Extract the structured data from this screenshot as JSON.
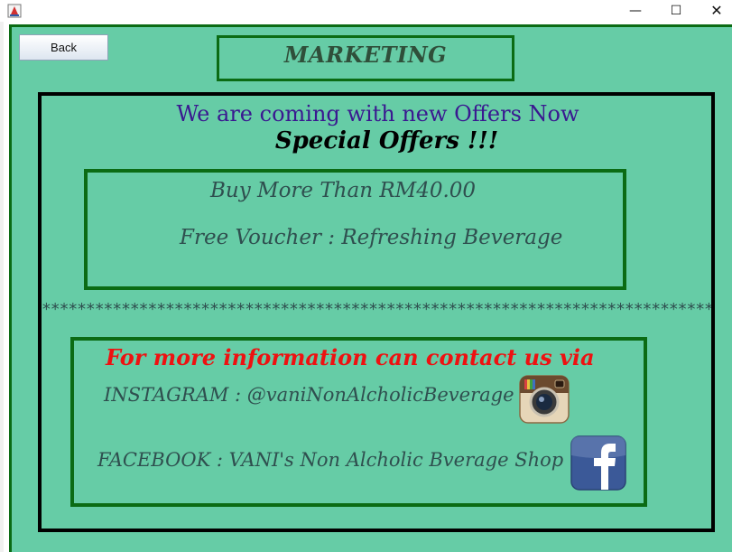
{
  "window": {
    "minimize": "—",
    "maximize": "☐",
    "close": "✕"
  },
  "toolbar": {
    "back_label": "Back"
  },
  "header": {
    "title": "MARKETING"
  },
  "promo": {
    "headline": "We are coming with new Offers Now",
    "special": "Special Offers !!!",
    "offer_line_1": "Buy More Than RM40.00",
    "offer_line_2": "Free Voucher : Refreshing Beverage"
  },
  "divider": "*****************************************************************************",
  "contact": {
    "title": "For more information can contact us via",
    "instagram": "INSTAGRAM : @vaniNonAlcholicBeverage",
    "facebook": "FACEBOOK  : VANI's Non Alcholic Bverage Shop"
  },
  "icons": {
    "app": "java-app-icon",
    "instagram": "instagram-icon",
    "facebook": "facebook-icon"
  },
  "colors": {
    "panel_background": "#66cca6",
    "frame_border": "#0b6b14",
    "headline": "#3a1890",
    "contact_title": "#ee1111"
  }
}
